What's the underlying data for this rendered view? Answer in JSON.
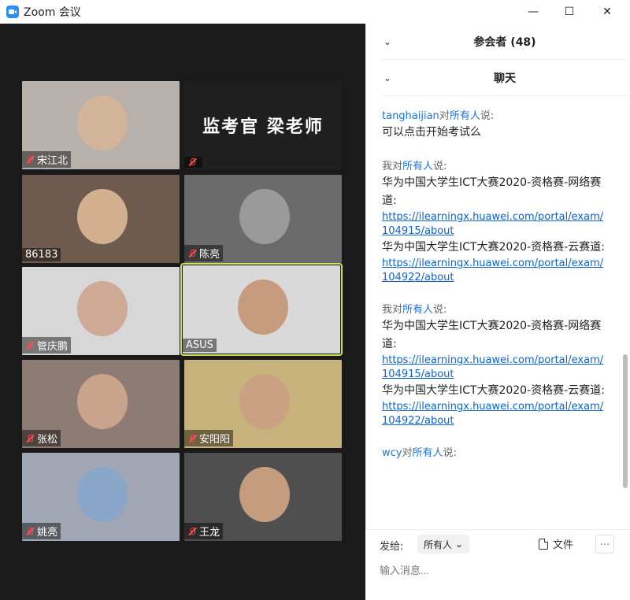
{
  "window": {
    "title": "Zoom 会议"
  },
  "participants_grid": [
    {
      "name": "宋江北",
      "muted": true,
      "bg": "#b8b0aa",
      "face": "#d2b49a"
    },
    {
      "name": "",
      "muted": true,
      "placeholder": "监考官 梁老师"
    },
    {
      "name": "86183",
      "muted": false,
      "bg": "#6f5b4d",
      "face": "#d3b08f"
    },
    {
      "name": "陈亮",
      "muted": true,
      "bg": "#6b6b6b",
      "face": "#9a9a9a"
    },
    {
      "name": "管庆鹏",
      "muted": true,
      "bg": "#d7d7d7",
      "face": "#cda996"
    },
    {
      "name": "ASUS",
      "muted": false,
      "bg": "#d9d9d9",
      "face": "#c79b7e",
      "highlight": true
    },
    {
      "name": "张松",
      "muted": true,
      "bg": "#8e7b74",
      "face": "#caa38c"
    },
    {
      "name": "安阳阳",
      "muted": true,
      "bg": "#c8b27b",
      "face": "#caa182"
    },
    {
      "name": "姚亮",
      "muted": true,
      "bg": "#a0a6b3",
      "face": "#8aa6c8"
    },
    {
      "name": "王龙",
      "muted": true,
      "bg": "#4f4f4f",
      "face": "#c69c7f"
    }
  ],
  "sidebar": {
    "participants_header": "参会者 (48)",
    "chat_header": "聊天"
  },
  "chat": [
    {
      "from": "tanghaijian",
      "to": "所有人",
      "say": "说:",
      "lines": [
        "可以点击开始考试么"
      ],
      "links": []
    },
    {
      "from": "我",
      "to": "所有人",
      "say": "说:",
      "lines": [
        "华为中国大学生ICT大赛2020-资格赛-网络赛道:",
        "https://ilearningx.huawei.com/portal/exam/104915/about",
        "华为中国大学生ICT大赛2020-资格赛-云赛道:",
        "https://ilearningx.huawei.com/portal/exam/104922/about"
      ]
    },
    {
      "from": "我",
      "to": "所有人",
      "say": "说:",
      "lines": [
        "华为中国大学生ICT大赛2020-资格赛-网络赛道:",
        "https://ilearningx.huawei.com/portal/exam/104915/about",
        "华为中国大学生ICT大赛2020-资格赛-云赛道:",
        "https://ilearningx.huawei.com/portal/exam/104922/about"
      ]
    },
    {
      "from": "wcy",
      "to": "所有人",
      "say": "说:",
      "lines": []
    }
  ],
  "composer": {
    "send_to_label": "发给:",
    "recipient": "所有人",
    "file_label": "文件",
    "placeholder": "输入消息..."
  }
}
